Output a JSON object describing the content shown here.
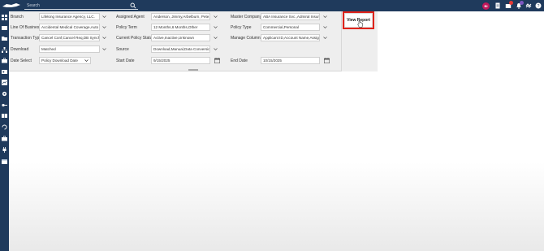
{
  "topbar": {
    "search_placeholder": "Search",
    "avatar_initials": "BI"
  },
  "filters": {
    "branch": {
      "label": "Branch",
      "value": "Lifelong Insurance Agency, LLC."
    },
    "line_of_business": {
      "label": "Line Of Business",
      "value": "Accidental Medical Coverage,Auto"
    },
    "transaction_type": {
      "label": "Transaction Type",
      "value": "Cancel Conf,Cancel Req,DB Synch."
    },
    "download": {
      "label": "Download",
      "value": "Matched"
    },
    "date_select": {
      "label": "Date Select",
      "value": "Policy Download Date"
    },
    "assigned_agent": {
      "label": "Assigned Agent",
      "value": "Anderson, Jimmy,Arbelburn, Pete,E"
    },
    "policy_term": {
      "label": "Policy Term",
      "value": "12 Months,6 Months,Other"
    },
    "current_policy_status": {
      "label": "Current Policy Status",
      "value": "Active,Inactive,Unknown"
    },
    "source": {
      "label": "Source",
      "value": "Download,Manual,Data Conversio"
    },
    "start_date": {
      "label": "Start Date",
      "value": "9/15/2025"
    },
    "master_company": {
      "label": "Master Company",
      "value": "ABA Insurance Svc.,Admiral Insura"
    },
    "policy_type": {
      "label": "Policy Type",
      "value": "Commercial,Personal"
    },
    "manage_columns": {
      "label": "Manage Columns",
      "value": "Applicant ID,Account Name,Assign"
    },
    "end_date": {
      "label": "End Date",
      "value": "10/15/2025"
    }
  },
  "actions": {
    "view_report": "View Report"
  },
  "colors": {
    "nav": "#1f3a5c",
    "panel": "#eeeeee",
    "highlight": "#e0231b",
    "avatar": "#c2185b"
  }
}
